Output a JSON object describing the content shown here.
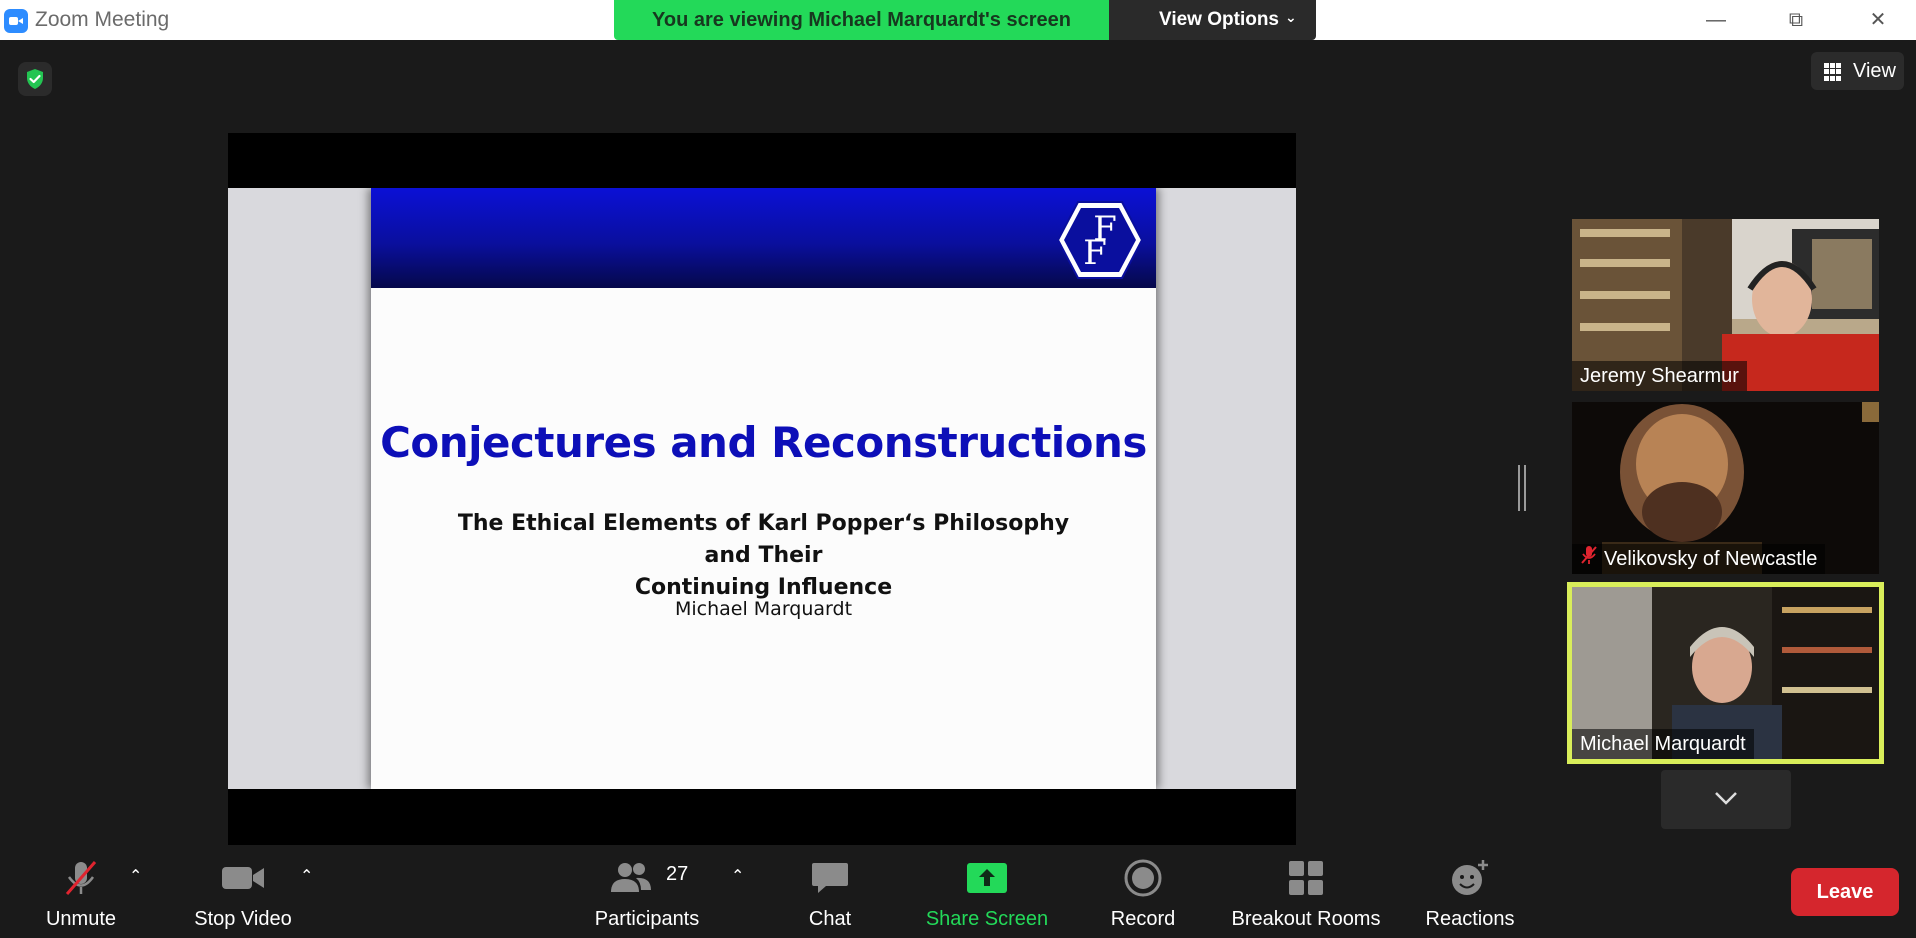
{
  "window": {
    "title": "Zoom Meeting",
    "minimize": "—",
    "restore": "⧉",
    "close": "✕"
  },
  "banner": {
    "viewing_text": "You are viewing Michael Marquardt's screen",
    "view_options_label": "View Options",
    "accent": "#23d959"
  },
  "view_button": {
    "label": "View"
  },
  "slide": {
    "title": "Conjectures and Reconstructions",
    "subtitle_line1": "The Ethical Elements of Karl Popper‘s Philosophy and Their",
    "subtitle_line2": "Continuing Influence",
    "author": "Michael Marquardt",
    "title_color": "#0d0fb8"
  },
  "participants": [
    {
      "name": "Jeremy Shearmur",
      "muted": false,
      "active": false
    },
    {
      "name": "Velikovsky of Newcastle",
      "muted": true,
      "active": false
    },
    {
      "name": "Michael Marquardt",
      "muted": false,
      "active": true
    }
  ],
  "toolbar": {
    "unmute": "Unmute",
    "stop_video": "Stop Video",
    "participants": "Participants",
    "participant_count": "27",
    "chat": "Chat",
    "share_screen": "Share Screen",
    "record": "Record",
    "breakout_rooms": "Breakout Rooms",
    "reactions": "Reactions",
    "leave": "Leave",
    "share_color": "#23d959",
    "leave_color": "#d5262d"
  }
}
